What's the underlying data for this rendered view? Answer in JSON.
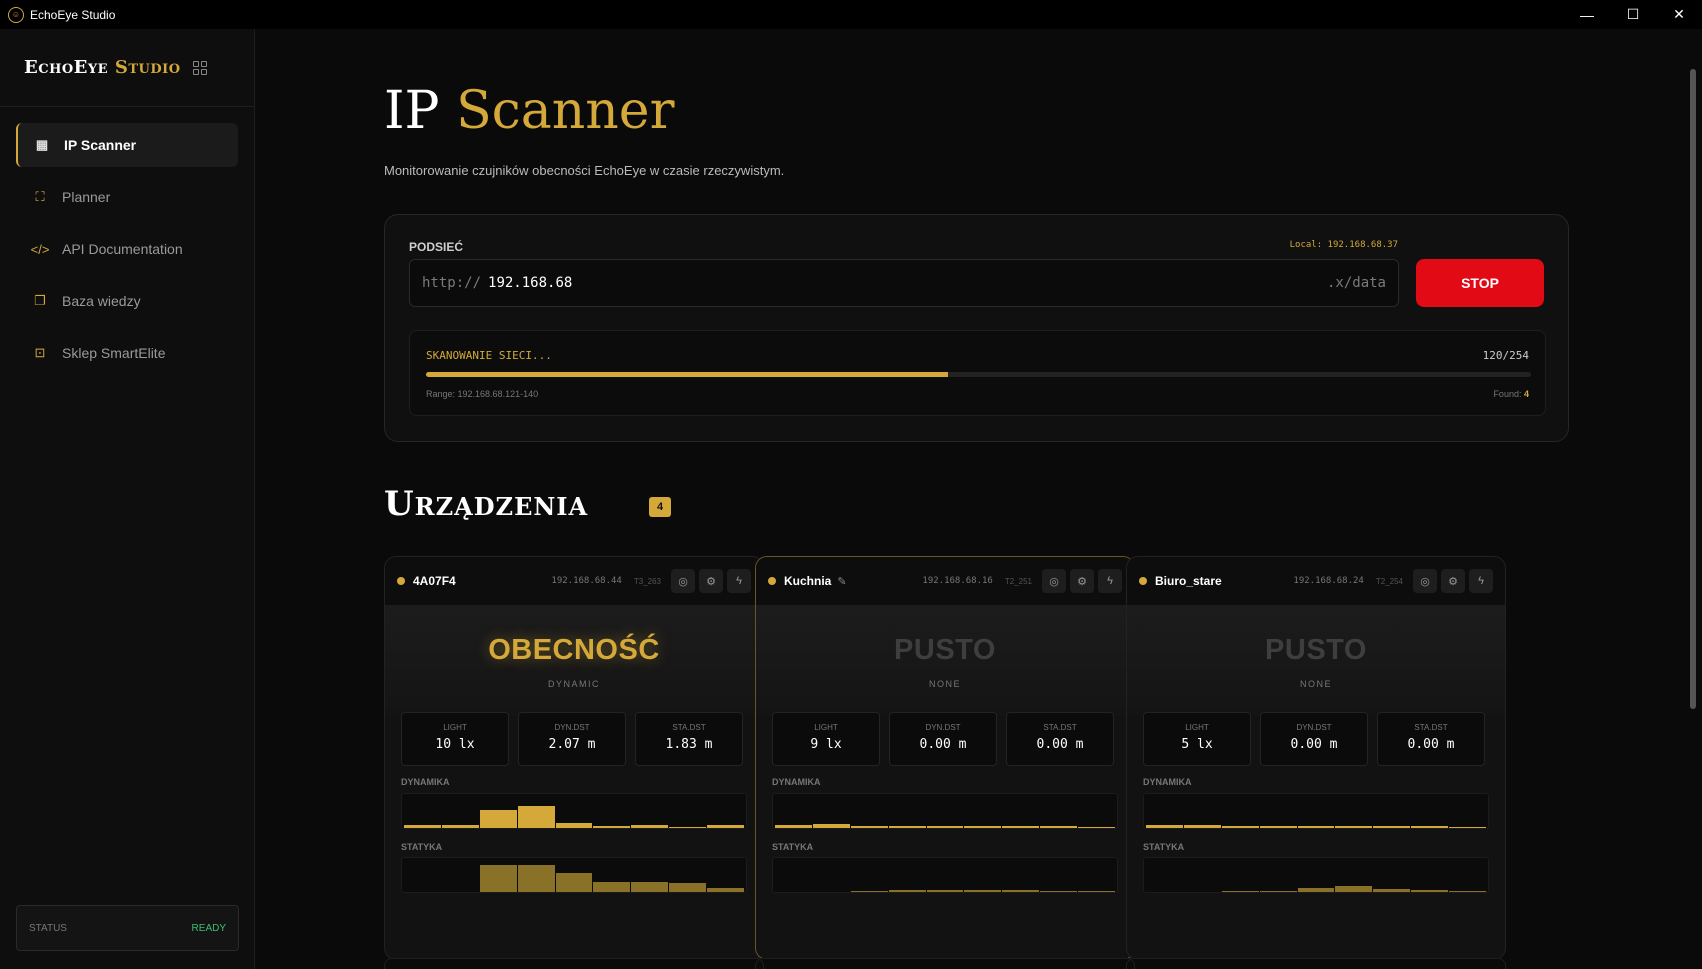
{
  "window": {
    "title": "EchoEye Studio",
    "controls": [
      "—",
      "☐",
      "✕"
    ]
  },
  "sidebar": {
    "brand_white": "EchoEye",
    "brand_gold": "Studio",
    "items": [
      {
        "label": "IP Scanner",
        "icon": "▦",
        "active": true
      },
      {
        "label": "Planner",
        "icon": "⛶"
      },
      {
        "label": "API Documentation",
        "icon": "</>"
      },
      {
        "label": "Baza wiedzy",
        "icon": "❐"
      },
      {
        "label": "Sklep SmartElite",
        "icon": "⊡"
      }
    ],
    "status_label": "STATUS",
    "status_value": "READY"
  },
  "header": {
    "title_white": "IP",
    "title_gold": "Scanner",
    "subtitle": "Monitorowanie czujników obecności EchoEye w czasie rzeczywistym."
  },
  "scanner": {
    "subnet_label": "PODSIEĆ",
    "local_ip": "Local: 192.168.68.37",
    "url_prefix": "http://",
    "url_value": "192.168.68",
    "url_suffix": ".x/data",
    "stop_label": "STOP",
    "scan_label": "SKANOWANIE SIECI...",
    "scan_count": "120/254",
    "progress": 0.472,
    "range": "Range: 192.168.68.121-140",
    "found_label": "Found:",
    "found_value": "4"
  },
  "devices": {
    "title": "Urządzenia",
    "count": "4",
    "cards": [
      {
        "name": "4A07F4",
        "ip": "192.168.68.44",
        "tag": "T3_263",
        "state": "OBECNOŚĆ",
        "mode": "DYNAMIC",
        "light": "10 lx",
        "dyn": "2.07 m",
        "sta": "1.83 m",
        "dyn_bars": [
          0.08,
          0.08,
          0.55,
          0.7,
          0.15,
          0.06,
          0.08,
          0.03,
          0.08
        ],
        "sta_bars": [
          0,
          0,
          0.85,
          0.85,
          0.6,
          0.32,
          0.3,
          0.28,
          0.14
        ]
      },
      {
        "name": "Kuchnia",
        "ip": "192.168.68.16",
        "tag": "T2_251",
        "state": "PUSTO",
        "mode": "NONE",
        "light": "9 lx",
        "dyn": "0.00 m",
        "sta": "0.00 m",
        "dyn_bars": [
          0.1,
          0.12,
          0.05,
          0.05,
          0.05,
          0.05,
          0.07,
          0.05,
          0.03
        ],
        "sta_bars": [
          0,
          0,
          0.04,
          0.06,
          0.06,
          0.06,
          0.05,
          0.03,
          0.03
        ]
      },
      {
        "name": "Biuro_stare",
        "ip": "192.168.68.24",
        "tag": "T2_254",
        "state": "PUSTO",
        "mode": "NONE",
        "light": "5 lx",
        "dyn": "0.00 m",
        "sta": "0.00 m",
        "dyn_bars": [
          0.1,
          0.08,
          0.05,
          0.05,
          0.05,
          0.05,
          0.05,
          0.05,
          0.03
        ],
        "sta_bars": [
          0,
          0,
          0.04,
          0.04,
          0.12,
          0.18,
          0.08,
          0.06,
          0.03
        ]
      }
    ],
    "metric_labels": {
      "light": "LIGHT",
      "dyn": "DYN.DST",
      "sta": "STA.DST"
    },
    "section_labels": {
      "dyn": "DYNAMIKA",
      "sta": "STATYKA"
    }
  },
  "colors": {
    "accent": "#d4a93a",
    "stop": "#e20b15",
    "ready": "#3fbf6f"
  }
}
